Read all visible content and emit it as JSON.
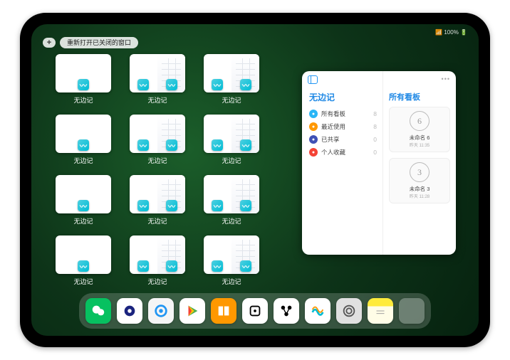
{
  "status": {
    "time": "",
    "right": "📶 100% 🔋"
  },
  "toolbar": {
    "plus": "+",
    "reopen": "重新打开已关闭的窗口"
  },
  "cards": [
    {
      "type": "single",
      "label": "无边记"
    },
    {
      "type": "cal",
      "label": "无边记"
    },
    {
      "type": "cal",
      "label": "无边记"
    },
    {
      "type": "single",
      "label": "无边记"
    },
    {
      "type": "cal",
      "label": "无边记"
    },
    {
      "type": "cal",
      "label": "无边记"
    },
    {
      "type": "single",
      "label": "无边记"
    },
    {
      "type": "cal",
      "label": "无边记"
    },
    {
      "type": "cal",
      "label": "无边记"
    },
    {
      "type": "single",
      "label": "无边记"
    },
    {
      "type": "cal",
      "label": "无边记"
    },
    {
      "type": "cal",
      "label": "无边记"
    }
  ],
  "panel": {
    "left_title": "无边记",
    "right_title": "所有看板",
    "rows": [
      {
        "icon": "blue",
        "label": "所有看板",
        "count": "8"
      },
      {
        "icon": "orng",
        "label": "最近使用",
        "count": "8"
      },
      {
        "icon": "ind",
        "label": "已共享",
        "count": "0"
      },
      {
        "icon": "red",
        "label": "个人收藏",
        "count": "0"
      }
    ],
    "boards": [
      {
        "glyph": "6",
        "name": "未命名 6",
        "sub": "昨天 11:35"
      },
      {
        "glyph": "3",
        "name": "未命名 3",
        "sub": "昨天 11:28"
      }
    ]
  },
  "dock": [
    {
      "name": "wechat",
      "bg": "#07c160"
    },
    {
      "name": "browser-a",
      "bg": "#ffffff"
    },
    {
      "name": "browser-b",
      "bg": "#f5f5f5"
    },
    {
      "name": "play",
      "bg": "#ffffff"
    },
    {
      "name": "books",
      "bg": "#ff9800"
    },
    {
      "name": "dice",
      "bg": "#ffffff"
    },
    {
      "name": "connect",
      "bg": "#ffffff"
    },
    {
      "name": "freeform",
      "bg": "#ffffff"
    },
    {
      "name": "settings",
      "bg": "#e0e0e0"
    },
    {
      "name": "notes",
      "bg": "linear-gradient(#ffeb3b 32%,#fffde7 32%)"
    },
    {
      "name": "folder",
      "bg": ""
    }
  ]
}
